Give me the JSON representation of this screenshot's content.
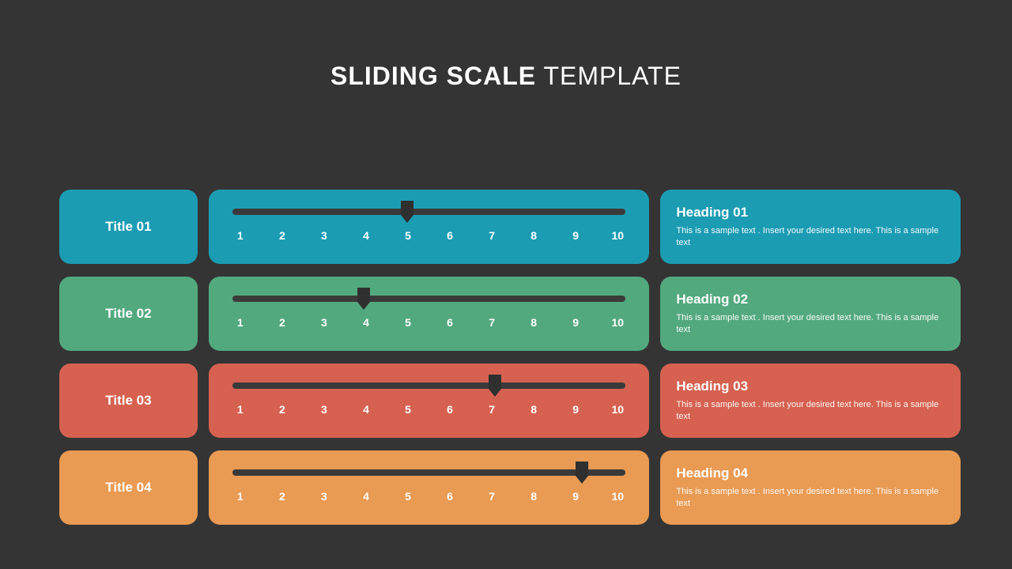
{
  "page_title_bold": "SLIDING SCALE",
  "page_title_light": " TEMPLATE",
  "tick_labels": [
    "1",
    "2",
    "3",
    "4",
    "5",
    "6",
    "7",
    "8",
    "9",
    "10"
  ],
  "rows": [
    {
      "color": "#1b9cb3",
      "title": "Title 01",
      "value": 5,
      "heading": "Heading 01",
      "desc": "This is a sample text . Insert your desired text here. This is a sample text"
    },
    {
      "color": "#53a97e",
      "title": "Title 02",
      "value": 4,
      "heading": "Heading 02",
      "desc": "This is a sample text . Insert your desired text here. This is a sample text"
    },
    {
      "color": "#d66150",
      "title": "Title 03",
      "value": 7,
      "heading": "Heading 03",
      "desc": "This is a sample text . Insert your desired text here. This is a sample text"
    },
    {
      "color": "#e99a53",
      "title": "Title 04",
      "value": 9,
      "heading": "Heading 04",
      "desc": "This is a sample text . Insert your desired text here. This is a sample text"
    }
  ]
}
